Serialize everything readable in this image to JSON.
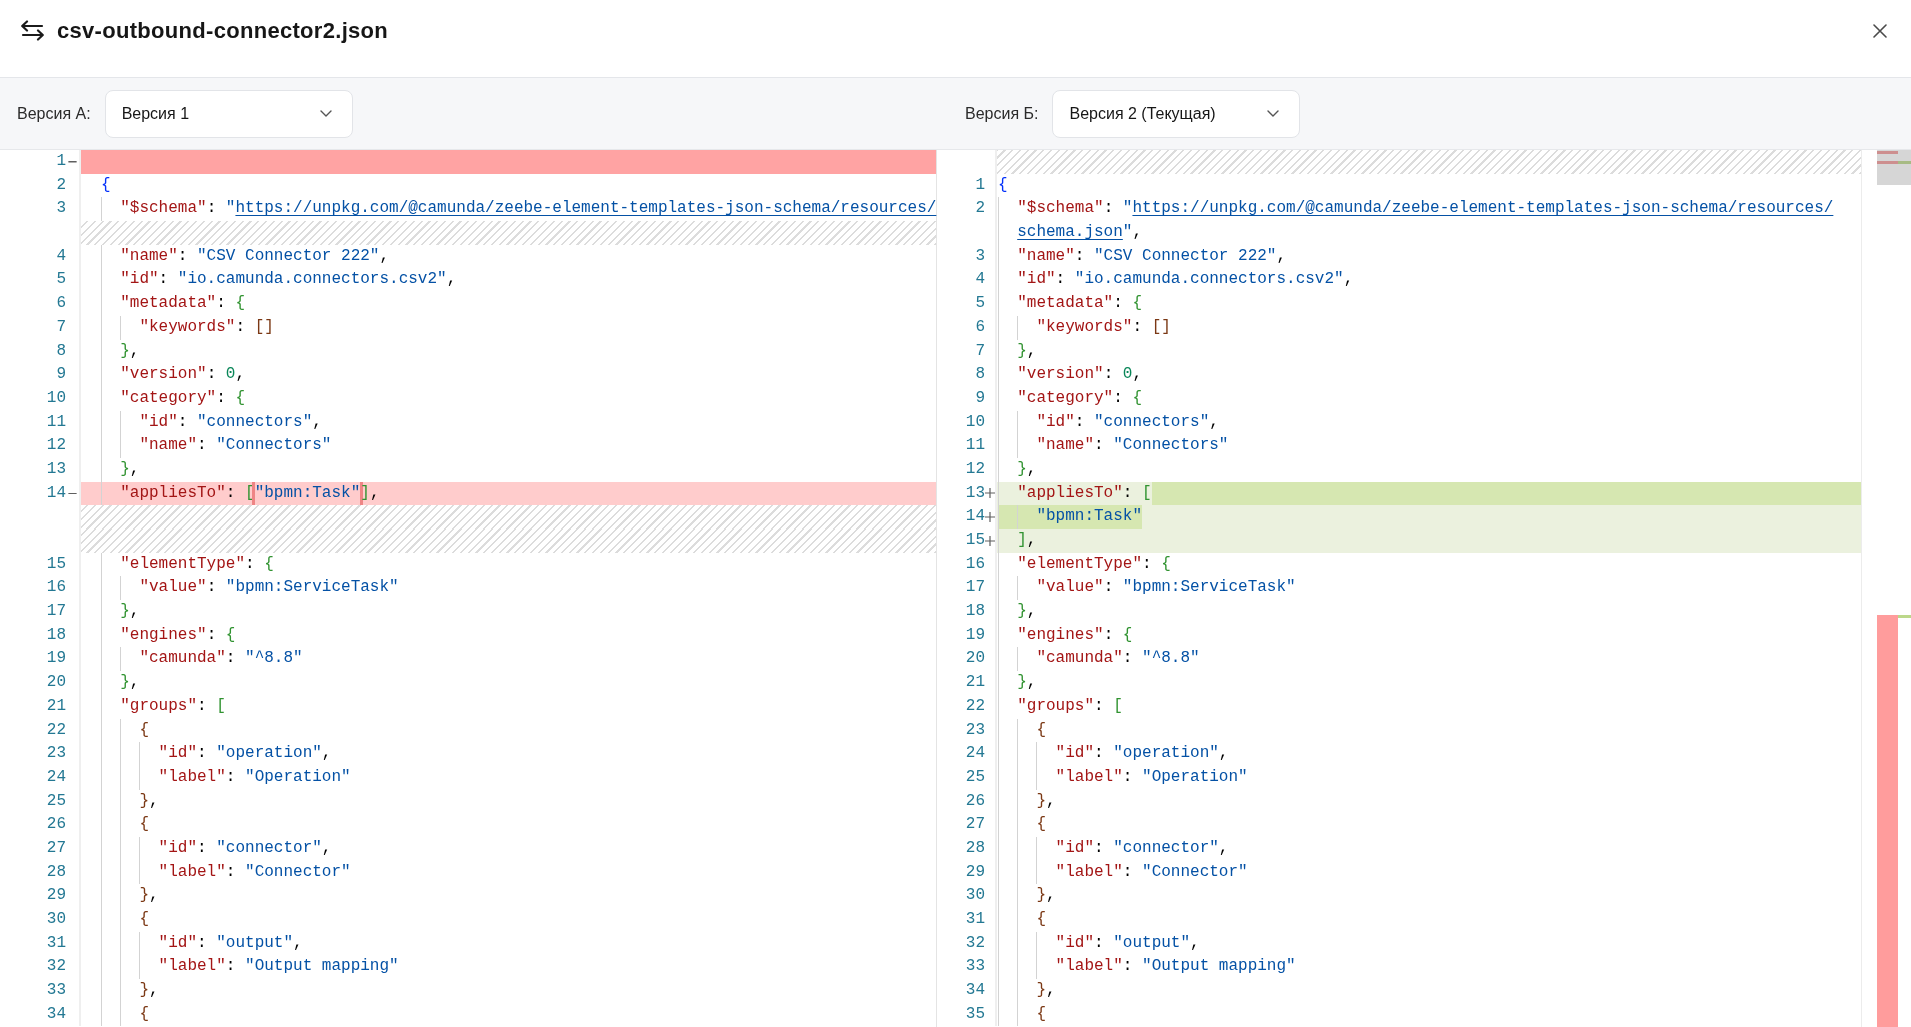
{
  "dialog": {
    "title": "csv-outbound-connector2.json"
  },
  "panes": [
    {
      "version_label": "Версия А:",
      "version": "Версия 1",
      "rows": [
        {
          "kind": "removed",
          "number": "1",
          "changed": true
        },
        {
          "kind": "plain",
          "number": "2",
          "tokens": [
            {
              "kind": "open",
              "text": "{"
            }
          ]
        },
        {
          "kind": "plain",
          "number": "3",
          "tokens": [
            {
              "kind": "key",
              "text": "  \"$schema\""
            },
            {
              "kind": "punct",
              "text": ": "
            },
            {
              "kind": "string",
              "text": "\""
            },
            {
              "kind": "link",
              "text": "https://unpkg.com/@camunda/zeebe-element-templates-json-schema/resources/"
            }
          ]
        },
        {
          "kind": "filler"
        },
        {
          "kind": "plain",
          "number": "4",
          "tokens": [
            {
              "kind": "key",
              "text": "  \"name\""
            },
            {
              "kind": "punct",
              "text": ": "
            },
            {
              "kind": "string",
              "text": "\"CSV Connector 222\""
            },
            {
              "kind": "punct",
              "text": ","
            }
          ]
        },
        {
          "kind": "plain",
          "number": "5",
          "tokens": [
            {
              "kind": "key",
              "text": "  \"id\""
            },
            {
              "kind": "punct",
              "text": ": "
            },
            {
              "kind": "string",
              "text": "\"io.camunda.connectors.csv2\""
            },
            {
              "kind": "punct",
              "text": ","
            }
          ]
        },
        {
          "kind": "plain",
          "number": "6",
          "tokens": [
            {
              "kind": "key",
              "text": "  \"metadata\""
            },
            {
              "kind": "punct",
              "text": ": "
            },
            {
              "kind": "open",
              "text": "{"
            }
          ]
        },
        {
          "kind": "plain",
          "number": "7",
          "tokens": [
            {
              "kind": "key",
              "text": "    \"keywords\""
            },
            {
              "kind": "punct",
              "text": ": "
            },
            {
              "kind": "open",
              "text": "["
            },
            {
              "kind": "close",
              "text": "]"
            }
          ]
        },
        {
          "kind": "plain",
          "number": "8",
          "tokens": [
            {
              "kind": "close",
              "text": "  }"
            },
            {
              "kind": "punct",
              "text": ","
            }
          ]
        },
        {
          "kind": "plain",
          "number": "9",
          "tokens": [
            {
              "kind": "key",
              "text": "  \"version\""
            },
            {
              "kind": "punct",
              "text": ": "
            },
            {
              "kind": "number",
              "text": "0"
            },
            {
              "kind": "punct",
              "text": ","
            }
          ]
        },
        {
          "kind": "plain",
          "number": "10",
          "tokens": [
            {
              "kind": "key",
              "text": "  \"category\""
            },
            {
              "kind": "punct",
              "text": ": "
            },
            {
              "kind": "open",
              "text": "{"
            }
          ]
        },
        {
          "kind": "plain",
          "number": "11",
          "tokens": [
            {
              "kind": "key",
              "text": "    \"id\""
            },
            {
              "kind": "punct",
              "text": ": "
            },
            {
              "kind": "string",
              "text": "\"connectors\""
            },
            {
              "kind": "punct",
              "text": ","
            }
          ]
        },
        {
          "kind": "plain",
          "number": "12",
          "tokens": [
            {
              "kind": "key",
              "text": "    \"name\""
            },
            {
              "kind": "punct",
              "text": ": "
            },
            {
              "kind": "string",
              "text": "\"Connectors\""
            }
          ]
        },
        {
          "kind": "plain",
          "number": "13",
          "tokens": [
            {
              "kind": "close",
              "text": "  }"
            },
            {
              "kind": "punct",
              "text": ","
            }
          ]
        },
        {
          "kind": "removed",
          "number": "14",
          "changed": false,
          "tokens": [
            {
              "kind": "key",
              "text": "  \"appliesTo\"",
              "changed": false
            },
            {
              "kind": "punct",
              "text": ": ",
              "changed": false
            },
            {
              "kind": "open",
              "text": "[",
              "changed": false
            },
            {
              "kind": "string",
              "text": "\"bpmn:Task\"",
              "changed": true
            },
            {
              "kind": "close",
              "text": "]",
              "changed": false
            },
            {
              "kind": "punct",
              "text": ",",
              "changed": false
            }
          ]
        },
        {
          "kind": "filler"
        },
        {
          "kind": "filler"
        },
        {
          "kind": "plain",
          "number": "15",
          "tokens": [
            {
              "kind": "key",
              "text": "  \"elementType\""
            },
            {
              "kind": "punct",
              "text": ": "
            },
            {
              "kind": "open",
              "text": "{"
            }
          ]
        },
        {
          "kind": "plain",
          "number": "16",
          "tokens": [
            {
              "kind": "key",
              "text": "    \"value\""
            },
            {
              "kind": "punct",
              "text": ": "
            },
            {
              "kind": "string",
              "text": "\"bpmn:ServiceTask\""
            }
          ]
        },
        {
          "kind": "plain",
          "number": "17",
          "tokens": [
            {
              "kind": "close",
              "text": "  }"
            },
            {
              "kind": "punct",
              "text": ","
            }
          ]
        },
        {
          "kind": "plain",
          "number": "18",
          "tokens": [
            {
              "kind": "key",
              "text": "  \"engines\""
            },
            {
              "kind": "punct",
              "text": ": "
            },
            {
              "kind": "open",
              "text": "{"
            }
          ]
        },
        {
          "kind": "plain",
          "number": "19",
          "tokens": [
            {
              "kind": "key",
              "text": "    \"camunda\""
            },
            {
              "kind": "punct",
              "text": ": "
            },
            {
              "kind": "string",
              "text": "\"^8.8\""
            }
          ]
        },
        {
          "kind": "plain",
          "number": "20",
          "tokens": [
            {
              "kind": "close",
              "text": "  }"
            },
            {
              "kind": "punct",
              "text": ","
            }
          ]
        },
        {
          "kind": "plain",
          "number": "21",
          "tokens": [
            {
              "kind": "key",
              "text": "  \"groups\""
            },
            {
              "kind": "punct",
              "text": ": "
            },
            {
              "kind": "open",
              "text": "["
            }
          ]
        },
        {
          "kind": "plain",
          "number": "22",
          "tokens": [
            {
              "kind": "open",
              "text": "    {"
            }
          ]
        },
        {
          "kind": "plain",
          "number": "23",
          "tokens": [
            {
              "kind": "key",
              "text": "      \"id\""
            },
            {
              "kind": "punct",
              "text": ": "
            },
            {
              "kind": "string",
              "text": "\"operation\""
            },
            {
              "kind": "punct",
              "text": ","
            }
          ]
        },
        {
          "kind": "plain",
          "number": "24",
          "tokens": [
            {
              "kind": "key",
              "text": "      \"label\""
            },
            {
              "kind": "punct",
              "text": ": "
            },
            {
              "kind": "string",
              "text": "\"Operation\""
            }
          ]
        },
        {
          "kind": "plain",
          "number": "25",
          "tokens": [
            {
              "kind": "close",
              "text": "    }"
            },
            {
              "kind": "punct",
              "text": ","
            }
          ]
        },
        {
          "kind": "plain",
          "number": "26",
          "tokens": [
            {
              "kind": "open",
              "text": "    {"
            }
          ]
        },
        {
          "kind": "plain",
          "number": "27",
          "tokens": [
            {
              "kind": "key",
              "text": "      \"id\""
            },
            {
              "kind": "punct",
              "text": ": "
            },
            {
              "kind": "string",
              "text": "\"connector\""
            },
            {
              "kind": "punct",
              "text": ","
            }
          ]
        },
        {
          "kind": "plain",
          "number": "28",
          "tokens": [
            {
              "kind": "key",
              "text": "      \"label\""
            },
            {
              "kind": "punct",
              "text": ": "
            },
            {
              "kind": "string",
              "text": "\"Connector\""
            }
          ]
        },
        {
          "kind": "plain",
          "number": "29",
          "tokens": [
            {
              "kind": "close",
              "text": "    }"
            },
            {
              "kind": "punct",
              "text": ","
            }
          ]
        },
        {
          "kind": "plain",
          "number": "30",
          "tokens": [
            {
              "kind": "open",
              "text": "    {"
            }
          ]
        },
        {
          "kind": "plain",
          "number": "31",
          "tokens": [
            {
              "kind": "key",
              "text": "      \"id\""
            },
            {
              "kind": "punct",
              "text": ": "
            },
            {
              "kind": "string",
              "text": "\"output\""
            },
            {
              "kind": "punct",
              "text": ","
            }
          ]
        },
        {
          "kind": "plain",
          "number": "32",
          "tokens": [
            {
              "kind": "key",
              "text": "      \"label\""
            },
            {
              "kind": "punct",
              "text": ": "
            },
            {
              "kind": "string",
              "text": "\"Output mapping\""
            }
          ]
        },
        {
          "kind": "plain",
          "number": "33",
          "tokens": [
            {
              "kind": "close",
              "text": "    }"
            },
            {
              "kind": "punct",
              "text": ","
            }
          ]
        },
        {
          "kind": "plain",
          "number": "34",
          "tokens": [
            {
              "kind": "open",
              "text": "    {"
            }
          ]
        }
      ]
    },
    {
      "version_label": "Версия Б:",
      "version": "Версия 2 (Текущая)",
      "rows": [
        {
          "kind": "filler"
        },
        {
          "kind": "plain",
          "number": "1",
          "tokens": [
            {
              "kind": "open",
              "text": "{"
            }
          ]
        },
        {
          "kind": "plain",
          "number": "2",
          "tokens": [
            {
              "kind": "key",
              "text": "  \"$schema\""
            },
            {
              "kind": "punct",
              "text": ": "
            },
            {
              "kind": "string",
              "text": "\""
            },
            {
              "kind": "link",
              "text": "https://unpkg.com/@camunda/zeebe-element-templates-json-schema/resources/"
            }
          ]
        },
        {
          "kind": "wrap",
          "tokens": [
            {
              "kind": "link",
              "text": "  schema.json"
            },
            {
              "kind": "string",
              "text": "\""
            },
            {
              "kind": "punct",
              "text": ","
            }
          ]
        },
        {
          "kind": "plain",
          "number": "3",
          "tokens": [
            {
              "kind": "key",
              "text": "  \"name\""
            },
            {
              "kind": "punct",
              "text": ": "
            },
            {
              "kind": "string",
              "text": "\"CSV Connector 222\""
            },
            {
              "kind": "punct",
              "text": ","
            }
          ]
        },
        {
          "kind": "plain",
          "number": "4",
          "tokens": [
            {
              "kind": "key",
              "text": "  \"id\""
            },
            {
              "kind": "punct",
              "text": ": "
            },
            {
              "kind": "string",
              "text": "\"io.camunda.connectors.csv2\""
            },
            {
              "kind": "punct",
              "text": ","
            }
          ]
        },
        {
          "kind": "plain",
          "number": "5",
          "tokens": [
            {
              "kind": "key",
              "text": "  \"metadata\""
            },
            {
              "kind": "punct",
              "text": ": "
            },
            {
              "kind": "open",
              "text": "{"
            }
          ]
        },
        {
          "kind": "plain",
          "number": "6",
          "tokens": [
            {
              "kind": "key",
              "text": "    \"keywords\""
            },
            {
              "kind": "punct",
              "text": ": "
            },
            {
              "kind": "open",
              "text": "["
            },
            {
              "kind": "close",
              "text": "]"
            }
          ]
        },
        {
          "kind": "plain",
          "number": "7",
          "tokens": [
            {
              "kind": "close",
              "text": "  }"
            },
            {
              "kind": "punct",
              "text": ","
            }
          ]
        },
        {
          "kind": "plain",
          "number": "8",
          "tokens": [
            {
              "kind": "key",
              "text": "  \"version\""
            },
            {
              "kind": "punct",
              "text": ": "
            },
            {
              "kind": "number",
              "text": "0"
            },
            {
              "kind": "punct",
              "text": ","
            }
          ]
        },
        {
          "kind": "plain",
          "number": "9",
          "tokens": [
            {
              "kind": "key",
              "text": "  \"category\""
            },
            {
              "kind": "punct",
              "text": ": "
            },
            {
              "kind": "open",
              "text": "{"
            }
          ]
        },
        {
          "kind": "plain",
          "number": "10",
          "tokens": [
            {
              "kind": "key",
              "text": "    \"id\""
            },
            {
              "kind": "punct",
              "text": ": "
            },
            {
              "kind": "string",
              "text": "\"connectors\""
            },
            {
              "kind": "punct",
              "text": ","
            }
          ]
        },
        {
          "kind": "plain",
          "number": "11",
          "tokens": [
            {
              "kind": "key",
              "text": "    \"name\""
            },
            {
              "kind": "punct",
              "text": ": "
            },
            {
              "kind": "string",
              "text": "\"Connectors\""
            }
          ]
        },
        {
          "kind": "plain",
          "number": "12",
          "tokens": [
            {
              "kind": "close",
              "text": "  }"
            },
            {
              "kind": "punct",
              "text": ","
            }
          ]
        },
        {
          "kind": "added",
          "number": "13",
          "changed": true,
          "tokens": [
            {
              "kind": "key",
              "text": "  \"appliesTo\"",
              "changed": false
            },
            {
              "kind": "punct",
              "text": ": ",
              "changed": false
            },
            {
              "kind": "open",
              "text": "[",
              "changed": false
            }
          ]
        },
        {
          "kind": "added",
          "number": "14",
          "changed": false,
          "tokens": [
            {
              "kind": "string",
              "text": "    \"bpmn:Task\"",
              "changed": true
            }
          ]
        },
        {
          "kind": "added",
          "number": "15",
          "changed": false,
          "tokens": [
            {
              "kind": "close",
              "text": "  ]",
              "changed": false
            },
            {
              "kind": "punct",
              "text": ",",
              "changed": false
            }
          ]
        },
        {
          "kind": "plain",
          "number": "16",
          "tokens": [
            {
              "kind": "key",
              "text": "  \"elementType\""
            },
            {
              "kind": "punct",
              "text": ": "
            },
            {
              "kind": "open",
              "text": "{"
            }
          ]
        },
        {
          "kind": "plain",
          "number": "17",
          "tokens": [
            {
              "kind": "key",
              "text": "    \"value\""
            },
            {
              "kind": "punct",
              "text": ": "
            },
            {
              "kind": "string",
              "text": "\"bpmn:ServiceTask\""
            }
          ]
        },
        {
          "kind": "plain",
          "number": "18",
          "tokens": [
            {
              "kind": "close",
              "text": "  }"
            },
            {
              "kind": "punct",
              "text": ","
            }
          ]
        },
        {
          "kind": "plain",
          "number": "19",
          "tokens": [
            {
              "kind": "key",
              "text": "  \"engines\""
            },
            {
              "kind": "punct",
              "text": ": "
            },
            {
              "kind": "open",
              "text": "{"
            }
          ]
        },
        {
          "kind": "plain",
          "number": "20",
          "tokens": [
            {
              "kind": "key",
              "text": "    \"camunda\""
            },
            {
              "kind": "punct",
              "text": ": "
            },
            {
              "kind": "string",
              "text": "\"^8.8\""
            }
          ]
        },
        {
          "kind": "plain",
          "number": "21",
          "tokens": [
            {
              "kind": "close",
              "text": "  }"
            },
            {
              "kind": "punct",
              "text": ","
            }
          ]
        },
        {
          "kind": "plain",
          "number": "22",
          "tokens": [
            {
              "kind": "key",
              "text": "  \"groups\""
            },
            {
              "kind": "punct",
              "text": ": "
            },
            {
              "kind": "open",
              "text": "["
            }
          ]
        },
        {
          "kind": "plain",
          "number": "23",
          "tokens": [
            {
              "kind": "open",
              "text": "    {"
            }
          ]
        },
        {
          "kind": "plain",
          "number": "24",
          "tokens": [
            {
              "kind": "key",
              "text": "      \"id\""
            },
            {
              "kind": "punct",
              "text": ": "
            },
            {
              "kind": "string",
              "text": "\"operation\""
            },
            {
              "kind": "punct",
              "text": ","
            }
          ]
        },
        {
          "kind": "plain",
          "number": "25",
          "tokens": [
            {
              "kind": "key",
              "text": "      \"label\""
            },
            {
              "kind": "punct",
              "text": ": "
            },
            {
              "kind": "string",
              "text": "\"Operation\""
            }
          ]
        },
        {
          "kind": "plain",
          "number": "26",
          "tokens": [
            {
              "kind": "close",
              "text": "    }"
            },
            {
              "kind": "punct",
              "text": ","
            }
          ]
        },
        {
          "kind": "plain",
          "number": "27",
          "tokens": [
            {
              "kind": "open",
              "text": "    {"
            }
          ]
        },
        {
          "kind": "plain",
          "number": "28",
          "tokens": [
            {
              "kind": "key",
              "text": "      \"id\""
            },
            {
              "kind": "punct",
              "text": ": "
            },
            {
              "kind": "string",
              "text": "\"connector\""
            },
            {
              "kind": "punct",
              "text": ","
            }
          ]
        },
        {
          "kind": "plain",
          "number": "29",
          "tokens": [
            {
              "kind": "key",
              "text": "      \"label\""
            },
            {
              "kind": "punct",
              "text": ": "
            },
            {
              "kind": "string",
              "text": "\"Connector\""
            }
          ]
        },
        {
          "kind": "plain",
          "number": "30",
          "tokens": [
            {
              "kind": "close",
              "text": "    }"
            },
            {
              "kind": "punct",
              "text": ","
            }
          ]
        },
        {
          "kind": "plain",
          "number": "31",
          "tokens": [
            {
              "kind": "open",
              "text": "    {"
            }
          ]
        },
        {
          "kind": "plain",
          "number": "32",
          "tokens": [
            {
              "kind": "key",
              "text": "      \"id\""
            },
            {
              "kind": "punct",
              "text": ": "
            },
            {
              "kind": "string",
              "text": "\"output\""
            },
            {
              "kind": "punct",
              "text": ","
            }
          ]
        },
        {
          "kind": "plain",
          "number": "33",
          "tokens": [
            {
              "kind": "key",
              "text": "      \"label\""
            },
            {
              "kind": "punct",
              "text": ": "
            },
            {
              "kind": "string",
              "text": "\"Output mapping\""
            }
          ]
        },
        {
          "kind": "plain",
          "number": "34",
          "tokens": [
            {
              "kind": "close",
              "text": "    }"
            },
            {
              "kind": "punct",
              "text": ","
            }
          ]
        },
        {
          "kind": "plain",
          "number": "35",
          "tokens": [
            {
              "kind": "open",
              "text": "    {"
            }
          ]
        }
      ]
    }
  ]
}
